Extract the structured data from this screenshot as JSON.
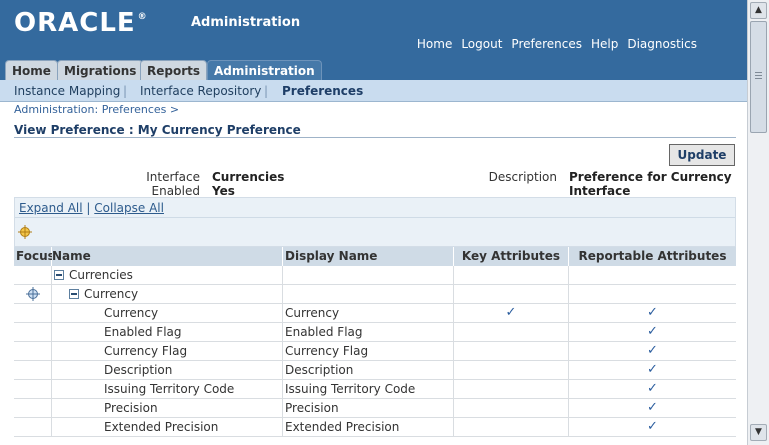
{
  "header": {
    "logo_text": "ORACLE",
    "app_title": "Administration",
    "global_links": [
      "Home",
      "Logout",
      "Preferences",
      "Help",
      "Diagnostics"
    ]
  },
  "tabs": [
    "Home",
    "Migrations",
    "Reports",
    "Administration"
  ],
  "subtabs": [
    "Instance Mapping",
    "Interface Repository",
    "Preferences"
  ],
  "breadcrumb": "Administration: Preferences  >",
  "page_title": "View Preference : My Currency Preference",
  "update_label": "Update",
  "fields": {
    "interface_label": "Interface",
    "interface_value": "Currencies",
    "enabled_label": "Enabled",
    "enabled_value": "Yes",
    "description_label": "Description",
    "description_value_1": "Preference for Currency",
    "description_value_2": "Interface"
  },
  "tree_controls": {
    "expand_all": "Expand All",
    "separator": "|",
    "collapse_all": "Collapse All"
  },
  "columns": {
    "focus": "Focus",
    "name": "Name",
    "display_name": "Display Name",
    "key_attributes": "Key Attributes",
    "reportable_attributes": "Reportable Attributes"
  },
  "rows": [
    {
      "name": "Currencies",
      "display": "",
      "key": false,
      "reportable": false
    },
    {
      "name": "Currency",
      "display": "",
      "key": false,
      "reportable": false
    },
    {
      "name": "Currency",
      "display": "Currency",
      "key": true,
      "reportable": true
    },
    {
      "name": "Enabled Flag",
      "display": "Enabled Flag",
      "key": false,
      "reportable": true
    },
    {
      "name": "Currency Flag",
      "display": "Currency Flag",
      "key": false,
      "reportable": true
    },
    {
      "name": "Description",
      "display": "Description",
      "key": false,
      "reportable": true
    },
    {
      "name": "Issuing Territory Code",
      "display": "Issuing Territory Code",
      "key": false,
      "reportable": true
    },
    {
      "name": "Precision",
      "display": "Precision",
      "key": false,
      "reportable": true
    },
    {
      "name": "Extended Precision",
      "display": "Extended Precision",
      "key": false,
      "reportable": true
    }
  ],
  "check_glyph": "✓"
}
